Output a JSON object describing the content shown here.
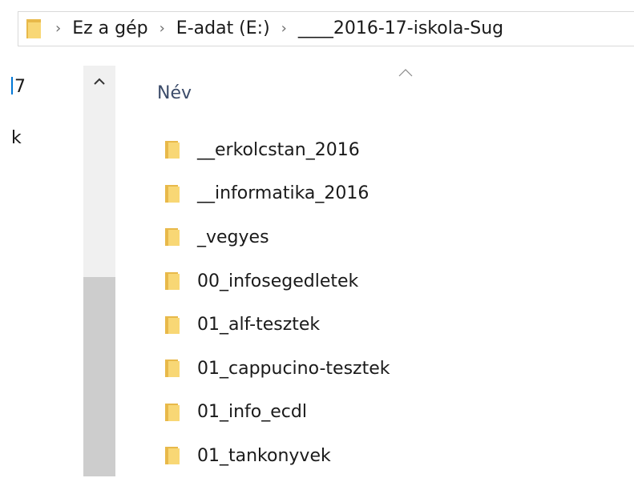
{
  "address_bar": {
    "folder_icon": "folder-icon",
    "separator_icon": "chevron-right-icon",
    "crumbs": [
      "Ez a gép",
      "E-adat (E:)",
      "____2016-17-iskola-Sug"
    ]
  },
  "nav_pane": {
    "items": [
      "7",
      "k"
    ]
  },
  "scrollbar": {
    "up_icon": "chevron-up-icon"
  },
  "file_list": {
    "sort_icon": "sort-ascending-icon",
    "column_name": "Név",
    "items": [
      "__erkolcstan_2016",
      "__informatika_2016",
      "_vegyes",
      "00_infosegedletek",
      "01_alf-tesztek",
      "01_cappucino-tesztek",
      "01_info_ecdl",
      "01_tankonyvek"
    ]
  },
  "colors": {
    "folder_front": "#f8d775",
    "folder_back": "#e8b94a",
    "header_text": "#3c4c6a",
    "scroll_track": "#f0f0f0",
    "scroll_thumb": "#cdcdcd"
  }
}
